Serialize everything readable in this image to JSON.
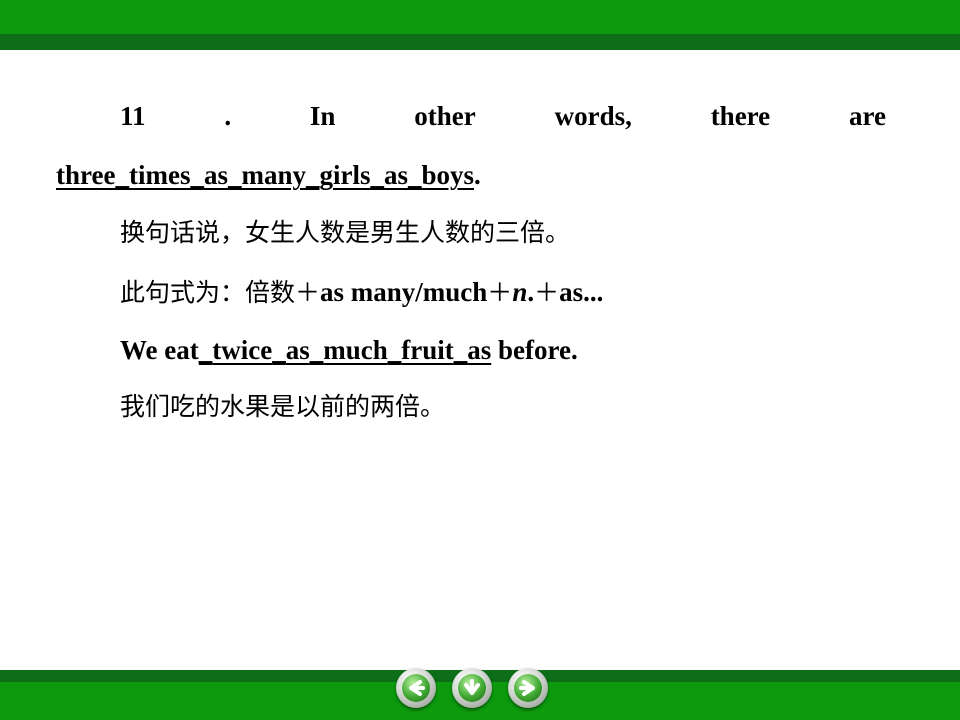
{
  "slide": {
    "line1": {
      "words": [
        "11",
        ".",
        "In",
        "other",
        "words,",
        "there",
        "are"
      ]
    },
    "line2": {
      "parts": [
        "three",
        "_",
        "times",
        "_",
        "as",
        "_",
        "many",
        "_",
        "girls",
        "_",
        "as",
        "_",
        "boys",
        "."
      ]
    },
    "line3": "换句话说，女生人数是男生人数的三倍。",
    "line4": {
      "prefix": "此句式为：倍数＋",
      "p1": "as many/much",
      "plus1": "＋",
      "n": "n",
      "dot": ".",
      "plus2": "＋",
      "p2": "as..."
    },
    "line5": {
      "lead": "We eat",
      "blank1": "_",
      "w1": "twice",
      "blank2": "_",
      "w2": "as",
      "blank3": "_",
      "w3": "much",
      "blank4": "_",
      "w4": "fruit",
      "blank5": "_",
      "w5": "as",
      "tail": " before."
    },
    "line6": "我们吃的水果是以前的两倍。"
  },
  "navigation": {
    "prev_icon": "arrow-left-icon",
    "down_icon": "arrow-down-icon",
    "next_icon": "arrow-right-icon"
  },
  "colors": {
    "bar_green": "#0d9a0d",
    "bar_dark_green": "#0e6e18"
  }
}
